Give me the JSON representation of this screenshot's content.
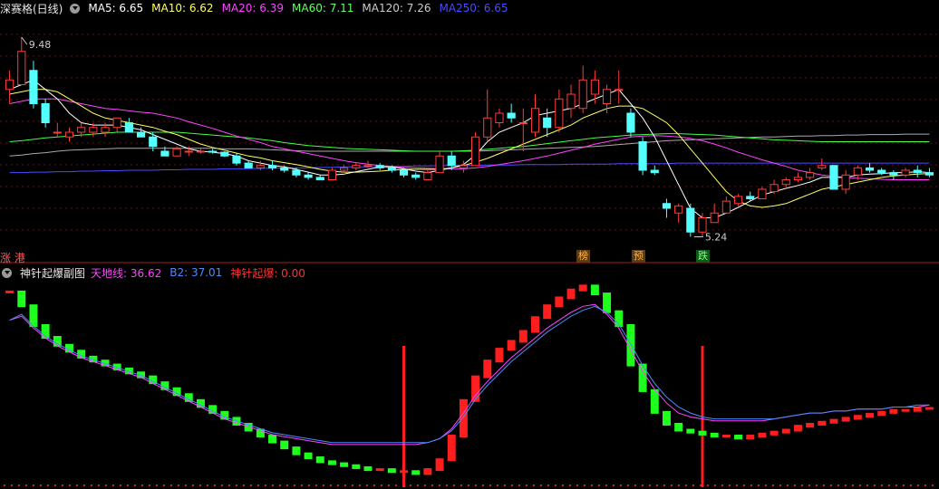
{
  "main_panel": {
    "title": "深赛格(日线)",
    "indicators": [
      {
        "label": "MA5: 6.65",
        "color": "#ffffff"
      },
      {
        "label": "MA10: 6.62",
        "color": "#ffff66"
      },
      {
        "label": "MA20: 6.39",
        "color": "#ff44ff"
      },
      {
        "label": "MA60: 7.11",
        "color": "#66ff66"
      },
      {
        "label": "MA120: 7.26",
        "color": "#cccccc"
      },
      {
        "label": "MA250: 6.65",
        "color": "#4a4aff"
      }
    ],
    "high_label": "9.48",
    "low_label": "5.24",
    "left_label": "涨 港",
    "markers": [
      {
        "text": "榜",
        "bg": "#5c3a12",
        "color": "#ffb347"
      },
      {
        "text": "预",
        "bg": "#5c3a12",
        "color": "#ffb347"
      },
      {
        "text": "跌",
        "bg": "#0f5a1a",
        "color": "#7cff7c"
      }
    ]
  },
  "sub_panel": {
    "title": "神针起爆副图",
    "indicators": [
      {
        "label": "天地线: 36.62",
        "color": "#ff44ff"
      },
      {
        "label": "B2: 37.01",
        "color": "#4a8cff"
      },
      {
        "label": "神针起爆: 0.00",
        "color": "#ff3333"
      }
    ]
  },
  "colors": {
    "up": "#ff3b3b",
    "down": "#54ffff",
    "grid": "#6a1010",
    "green_bar": "#1eff1e",
    "red_bar": "#ff1e1e"
  },
  "chart_data": {
    "type": "candlestick",
    "candles": [
      [
        8.2,
        8.6,
        7.9,
        8.4
      ],
      [
        8.3,
        9.3,
        8.3,
        9.0
      ],
      [
        8.6,
        8.8,
        7.8,
        7.9
      ],
      [
        7.9,
        8.0,
        7.4,
        7.5
      ],
      [
        7.3,
        7.5,
        7.2,
        7.3
      ],
      [
        7.2,
        7.4,
        7.1,
        7.3
      ],
      [
        7.3,
        7.5,
        7.2,
        7.4
      ],
      [
        7.3,
        7.5,
        7.2,
        7.4
      ],
      [
        7.3,
        7.5,
        7.2,
        7.4
      ],
      [
        7.4,
        7.6,
        7.3,
        7.6
      ],
      [
        7.5,
        7.6,
        7.3,
        7.3
      ],
      [
        7.3,
        7.4,
        7.2,
        7.2
      ],
      [
        7.2,
        7.3,
        6.9,
        7.0
      ],
      [
        6.9,
        7.0,
        6.8,
        6.8
      ],
      [
        6.8,
        7.0,
        6.8,
        6.95
      ],
      [
        6.9,
        7.0,
        6.8,
        6.9
      ],
      [
        6.9,
        6.95,
        6.85,
        6.9
      ],
      [
        6.9,
        6.95,
        6.85,
        6.88
      ],
      [
        6.88,
        6.9,
        6.78,
        6.8
      ],
      [
        6.8,
        6.85,
        6.6,
        6.65
      ],
      [
        6.65,
        6.7,
        6.55,
        6.55
      ],
      [
        6.55,
        6.7,
        6.5,
        6.6
      ],
      [
        6.6,
        6.7,
        6.5,
        6.55
      ],
      [
        6.55,
        6.6,
        6.45,
        6.5
      ],
      [
        6.5,
        6.55,
        6.35,
        6.4
      ],
      [
        6.4,
        6.45,
        6.3,
        6.35
      ],
      [
        6.35,
        6.4,
        6.3,
        6.3
      ],
      [
        6.3,
        6.55,
        6.3,
        6.5
      ],
      [
        6.5,
        6.6,
        6.45,
        6.55
      ],
      [
        6.55,
        6.65,
        6.5,
        6.6
      ],
      [
        6.6,
        6.7,
        6.55,
        6.6
      ],
      [
        6.6,
        6.65,
        6.5,
        6.55
      ],
      [
        6.55,
        6.6,
        6.45,
        6.5
      ],
      [
        6.5,
        6.55,
        6.35,
        6.4
      ],
      [
        6.4,
        6.45,
        6.3,
        6.35
      ],
      [
        6.3,
        6.5,
        6.3,
        6.45
      ],
      [
        6.45,
        6.9,
        6.45,
        6.8
      ],
      [
        6.8,
        6.9,
        6.5,
        6.6
      ],
      [
        6.55,
        6.7,
        6.45,
        6.6
      ],
      [
        6.6,
        7.3,
        6.6,
        7.2
      ],
      [
        7.2,
        8.2,
        7.1,
        7.6
      ],
      [
        7.5,
        7.8,
        7.4,
        7.7
      ],
      [
        7.7,
        7.9,
        7.5,
        7.6
      ],
      [
        7.5,
        7.8,
        6.9,
        7.5
      ],
      [
        7.3,
        8.1,
        7.2,
        7.8
      ],
      [
        7.6,
        7.8,
        7.2,
        7.4
      ],
      [
        7.4,
        8.2,
        7.3,
        8.0
      ],
      [
        7.8,
        8.3,
        7.6,
        8.1
      ],
      [
        7.8,
        8.7,
        7.7,
        8.4
      ],
      [
        8.1,
        8.6,
        7.9,
        8.4
      ],
      [
        7.9,
        8.3,
        7.7,
        8.2
      ],
      [
        8.2,
        8.6,
        7.9,
        8.2
      ],
      [
        7.7,
        7.8,
        7.2,
        7.3
      ],
      [
        7.1,
        7.2,
        6.4,
        6.5
      ],
      [
        6.5,
        6.6,
        6.4,
        6.45
      ],
      [
        5.8,
        5.9,
        5.5,
        5.7
      ],
      [
        5.6,
        5.8,
        5.4,
        5.75
      ],
      [
        5.7,
        5.8,
        5.1,
        5.2
      ],
      [
        5.2,
        5.6,
        5.1,
        5.5
      ],
      [
        5.4,
        5.8,
        5.4,
        5.6
      ],
      [
        5.6,
        5.95,
        5.6,
        5.85
      ],
      [
        5.8,
        6.0,
        5.75,
        5.95
      ],
      [
        5.95,
        6.05,
        5.85,
        5.9
      ],
      [
        5.9,
        6.15,
        5.9,
        6.1
      ],
      [
        6.05,
        6.3,
        6.0,
        6.2
      ],
      [
        6.2,
        6.35,
        6.1,
        6.3
      ],
      [
        6.3,
        6.45,
        6.25,
        6.35
      ],
      [
        6.35,
        6.55,
        6.3,
        6.45
      ],
      [
        6.55,
        6.75,
        6.5,
        6.6
      ],
      [
        6.6,
        6.55,
        6.1,
        6.1
      ],
      [
        6.1,
        6.5,
        6.0,
        6.4
      ],
      [
        6.4,
        6.6,
        6.3,
        6.55
      ],
      [
        6.55,
        6.65,
        6.45,
        6.5
      ],
      [
        6.5,
        6.55,
        6.4,
        6.45
      ],
      [
        6.45,
        6.5,
        6.3,
        6.4
      ],
      [
        6.4,
        6.55,
        6.35,
        6.5
      ],
      [
        6.5,
        6.6,
        6.35,
        6.45
      ],
      [
        6.45,
        6.55,
        6.35,
        6.4
      ]
    ],
    "ma5": [
      8.2,
      8.3,
      8.4,
      8.2,
      8.0,
      7.7,
      7.5,
      7.45,
      7.45,
      7.45,
      7.4,
      7.35,
      7.25,
      7.15,
      7.05,
      6.95,
      6.9,
      6.88,
      6.85,
      6.8,
      6.7,
      6.65,
      6.6,
      6.57,
      6.52,
      6.46,
      6.4,
      6.4,
      6.42,
      6.47,
      6.52,
      6.57,
      6.57,
      6.53,
      6.48,
      6.45,
      6.5,
      6.55,
      6.62,
      6.82,
      7.1,
      7.3,
      7.4,
      7.5,
      7.65,
      7.7,
      7.75,
      7.8,
      7.9,
      8.0,
      8.1,
      8.2,
      7.9,
      7.6,
      7.2,
      6.7,
      6.2,
      5.7,
      5.5,
      5.5,
      5.6,
      5.72,
      5.85,
      5.98,
      6.05,
      6.12,
      6.18,
      6.25,
      6.35,
      6.35,
      6.35,
      6.4,
      6.42,
      6.43,
      6.45,
      6.45,
      6.47,
      6.45
    ],
    "ma10": [
      8.1,
      8.15,
      8.2,
      8.2,
      8.15,
      8.0,
      7.85,
      7.7,
      7.6,
      7.55,
      7.5,
      7.45,
      7.4,
      7.32,
      7.25,
      7.15,
      7.05,
      6.98,
      6.92,
      6.86,
      6.8,
      6.76,
      6.7,
      6.66,
      6.62,
      6.57,
      6.52,
      6.48,
      6.46,
      6.46,
      6.47,
      6.48,
      6.5,
      6.52,
      6.52,
      6.52,
      6.52,
      6.55,
      6.6,
      6.67,
      6.75,
      6.85,
      6.95,
      7.05,
      7.15,
      7.25,
      7.35,
      7.45,
      7.6,
      7.7,
      7.8,
      7.85,
      7.85,
      7.8,
      7.65,
      7.5,
      7.25,
      6.95,
      6.65,
      6.35,
      6.05,
      5.85,
      5.75,
      5.72,
      5.75,
      5.8,
      5.9,
      6.0,
      6.1,
      6.15,
      6.2,
      6.25,
      6.3,
      6.35,
      6.38,
      6.4,
      6.42,
      6.43
    ],
    "ma20": [
      7.9,
      7.95,
      8.0,
      8.0,
      8.0,
      7.95,
      7.9,
      7.85,
      7.8,
      7.78,
      7.75,
      7.72,
      7.7,
      7.65,
      7.6,
      7.52,
      7.45,
      7.38,
      7.3,
      7.22,
      7.15,
      7.08,
      7.0,
      6.95,
      6.9,
      6.85,
      6.8,
      6.75,
      6.7,
      6.66,
      6.63,
      6.6,
      6.58,
      6.56,
      6.55,
      6.54,
      6.53,
      6.53,
      6.53,
      6.55,
      6.58,
      6.62,
      6.66,
      6.7,
      6.75,
      6.8,
      6.86,
      6.92,
      6.98,
      7.05,
      7.1,
      7.15,
      7.2,
      7.22,
      7.23,
      7.22,
      7.2,
      7.17,
      7.12,
      7.05,
      6.97,
      6.88,
      6.8,
      6.72,
      6.65,
      6.58,
      6.5,
      6.45,
      6.4,
      6.37,
      6.35,
      6.33,
      6.32,
      6.31,
      6.3,
      6.3,
      6.3,
      6.3
    ],
    "ma60": [
      7.1,
      7.12,
      7.15,
      7.18,
      7.2,
      7.22,
      7.24,
      7.26,
      7.28,
      7.3,
      7.3,
      7.3,
      7.3,
      7.3,
      7.3,
      7.28,
      7.26,
      7.24,
      7.22,
      7.2,
      7.18,
      7.15,
      7.12,
      7.08,
      7.05,
      7.02,
      7.0,
      6.98,
      6.96,
      6.95,
      6.94,
      6.93,
      6.92,
      6.91,
      6.9,
      6.9,
      6.9,
      6.9,
      6.91,
      6.92,
      6.94,
      6.96,
      6.98,
      7.0,
      7.03,
      7.06,
      7.09,
      7.12,
      7.15,
      7.18,
      7.2,
      7.22,
      7.24,
      7.25,
      7.26,
      7.27,
      7.27,
      7.26,
      7.25,
      7.24,
      7.22,
      7.2,
      7.18,
      7.16,
      7.14,
      7.13,
      7.12,
      7.11,
      7.1,
      7.1,
      7.1,
      7.1,
      7.1,
      7.1,
      7.1,
      7.1,
      7.1,
      7.1
    ],
    "ma120": [
      6.8,
      6.82,
      6.85,
      6.87,
      6.9,
      6.92,
      6.93,
      6.94,
      6.95,
      6.96,
      6.96,
      6.96,
      6.96,
      6.96,
      6.96,
      6.96,
      6.96,
      6.96,
      6.95,
      6.95,
      6.95,
      6.94,
      6.93,
      6.92,
      6.91,
      6.9,
      6.9,
      6.9,
      6.9,
      6.9,
      6.9,
      6.9,
      6.9,
      6.9,
      6.9,
      6.9,
      6.9,
      6.9,
      6.9,
      6.9,
      6.91,
      6.92,
      6.93,
      6.94,
      6.95,
      6.96,
      6.97,
      6.98,
      6.99,
      7.0,
      7.02,
      7.04,
      7.06,
      7.08,
      7.1,
      7.12,
      7.13,
      7.14,
      7.15,
      7.16,
      7.17,
      7.18,
      7.19,
      7.2,
      7.2,
      7.21,
      7.22,
      7.22,
      7.23,
      7.23,
      7.24,
      7.24,
      7.25,
      7.25,
      7.25,
      7.26,
      7.26,
      7.26
    ],
    "ma250": [
      6.45,
      6.45,
      6.46,
      6.46,
      6.47,
      6.47,
      6.48,
      6.48,
      6.49,
      6.49,
      6.5,
      6.5,
      6.5,
      6.51,
      6.51,
      6.52,
      6.52,
      6.52,
      6.53,
      6.53,
      6.53,
      6.54,
      6.54,
      6.55,
      6.55,
      6.55,
      6.56,
      6.56,
      6.57,
      6.57,
      6.57,
      6.58,
      6.58,
      6.58,
      6.59,
      6.59,
      6.6,
      6.6,
      6.6,
      6.6,
      6.61,
      6.61,
      6.61,
      6.62,
      6.62,
      6.62,
      6.62,
      6.63,
      6.63,
      6.63,
      6.63,
      6.64,
      6.64,
      6.64,
      6.64,
      6.64,
      6.65,
      6.65,
      6.65,
      6.65,
      6.65,
      6.65,
      6.65,
      6.65,
      6.65,
      6.65,
      6.65,
      6.65,
      6.65,
      6.65,
      6.65,
      6.65,
      6.65,
      6.65,
      6.65,
      6.65,
      6.65,
      6.65
    ],
    "sub_bars": [
      95,
      88,
      78,
      72,
      68,
      65,
      62,
      60,
      58,
      56,
      54,
      52,
      49,
      46,
      43,
      40,
      37,
      34,
      31,
      28,
      25,
      22,
      19,
      16,
      13,
      11,
      9,
      8,
      7,
      6,
      5,
      5,
      4,
      4,
      3,
      5,
      10,
      22,
      40,
      52,
      60,
      66,
      70,
      75,
      82,
      88,
      92,
      96,
      98,
      94,
      85,
      78,
      58,
      45,
      34,
      28,
      25,
      24,
      23,
      22,
      22,
      21,
      22,
      23,
      24,
      25,
      27,
      28,
      29,
      30,
      31,
      32,
      33,
      34,
      35,
      35,
      36,
      36
    ],
    "sub_line": [
      80,
      82,
      76,
      71,
      67,
      64,
      61,
      59,
      57,
      55,
      53,
      51,
      48,
      45,
      42,
      39,
      36,
      33,
      30,
      28,
      26,
      24,
      22,
      21,
      20,
      19,
      18,
      17,
      17,
      17,
      17,
      17,
      17,
      17,
      17,
      18,
      20,
      25,
      33,
      42,
      49,
      55,
      61,
      66,
      71,
      76,
      80,
      84,
      87,
      88,
      83,
      76,
      65,
      54,
      45,
      38,
      33,
      31,
      30,
      29,
      29,
      29,
      29,
      29,
      30,
      31,
      32,
      33,
      33,
      34,
      34,
      35,
      35,
      35,
      36,
      36,
      36,
      37
    ],
    "sub_line2": [
      80,
      83,
      77,
      72,
      68,
      65,
      62,
      60,
      58,
      56,
      54,
      52,
      49,
      46,
      43,
      40,
      37,
      34,
      31,
      29,
      27,
      25,
      23,
      22,
      21,
      20,
      19,
      18,
      18,
      18,
      18,
      18,
      18,
      18,
      18,
      18,
      20,
      24,
      31,
      40,
      47,
      53,
      59,
      64,
      69,
      74,
      78,
      82,
      85,
      87,
      84,
      78,
      68,
      57,
      48,
      41,
      36,
      33,
      31,
      30,
      30,
      30,
      30,
      30,
      30,
      31,
      32,
      33,
      33,
      34,
      34,
      35,
      35,
      35,
      36,
      36,
      37,
      37
    ],
    "spikes": [
      33,
      58
    ]
  }
}
